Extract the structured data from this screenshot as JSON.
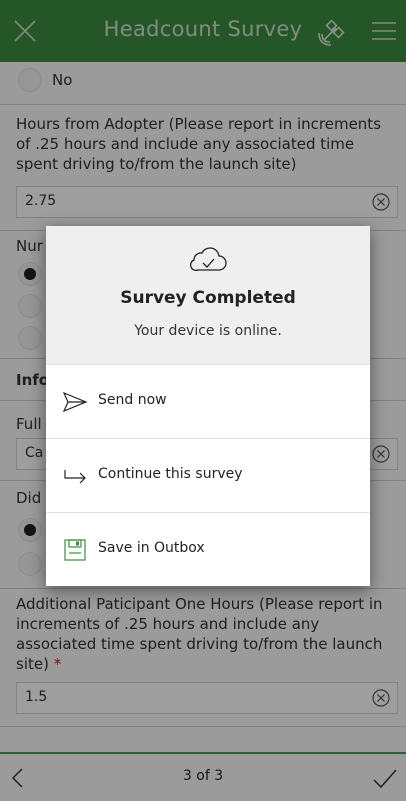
{
  "header": {
    "title": "Headcount Survey"
  },
  "form": {
    "no_option": "No",
    "hours_adopter_label": "Hours from Adopter (Please report in increments of .25 hours and include any associated time spent driving to/from the launch site)",
    "hours_adopter_value": "2.75",
    "num_label_partial": "Nur",
    "info_section_partial": "Info",
    "full_label_partial": "Full",
    "full_value_partial": "Ca",
    "did_label_partial": "Did",
    "additional_hours_label": "Additional Paticipant One Hours (Please report in increments of .25 hours and include any associated time spent driving to/from the launch site)",
    "required_mark": "*",
    "additional_hours_value": "1.5"
  },
  "dialog": {
    "title": "Survey Completed",
    "subtitle": "Your device is online.",
    "options": [
      {
        "label": "Send now",
        "icon": "send-icon"
      },
      {
        "label": "Continue this survey",
        "icon": "continue-arrow-icon"
      },
      {
        "label": "Save in Outbox",
        "icon": "save-disk-icon"
      }
    ]
  },
  "footer": {
    "page_indicator": "3 of 3"
  },
  "colors": {
    "header_bg": "#3d8b3f",
    "accent_green": "#4c9a4e"
  }
}
